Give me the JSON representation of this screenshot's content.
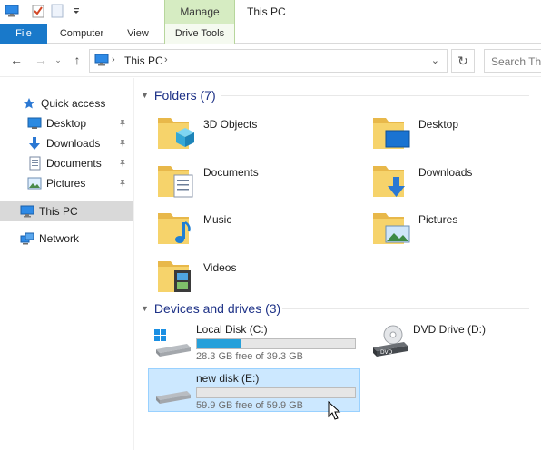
{
  "window": {
    "title": "This PC",
    "context_tab_group": "Manage"
  },
  "ribbon": {
    "tabs": [
      {
        "label": "File"
      },
      {
        "label": "Computer"
      },
      {
        "label": "View"
      },
      {
        "label": "Drive Tools"
      }
    ]
  },
  "address_bar": {
    "crumb": "This PC",
    "search_placeholder": "Search This PC"
  },
  "nav_pane": {
    "quick_access": "Quick access",
    "items": [
      {
        "label": "Desktop",
        "icon": "desktop-icon",
        "pinned": true
      },
      {
        "label": "Downloads",
        "icon": "downloads-icon",
        "pinned": true
      },
      {
        "label": "Documents",
        "icon": "documents-icon",
        "pinned": true
      },
      {
        "label": "Pictures",
        "icon": "pictures-icon",
        "pinned": true
      }
    ],
    "this_pc": "This PC",
    "network": "Network"
  },
  "folders": {
    "header": "Folders (7)",
    "items": [
      {
        "label": "3D Objects",
        "icon": "3d-objects-folder-icon"
      },
      {
        "label": "Desktop",
        "icon": "desktop-folder-icon"
      },
      {
        "label": "Documents",
        "icon": "documents-folder-icon"
      },
      {
        "label": "Downloads",
        "icon": "downloads-folder-icon"
      },
      {
        "label": "Music",
        "icon": "music-folder-icon"
      },
      {
        "label": "Pictures",
        "icon": "pictures-folder-icon"
      },
      {
        "label": "Videos",
        "icon": "videos-folder-icon"
      }
    ]
  },
  "drives": {
    "header": "Devices and drives (3)",
    "items": [
      {
        "label": "Local Disk (C:)",
        "free_text": "28.3 GB free of 39.3 GB",
        "used_fraction": 0.28,
        "selected": false
      },
      {
        "label": "DVD Drive (D:)",
        "free_text": "",
        "used_fraction": null,
        "selected": false
      },
      {
        "label": "new disk (E:)",
        "free_text": "59.9 GB free of 59.9 GB",
        "used_fraction": 0.0,
        "selected": true
      }
    ]
  },
  "colors": {
    "accent": "#1979ca",
    "header_text": "#1e3287",
    "selection": "#cce8ff",
    "usage_bar": "#26a0da"
  }
}
